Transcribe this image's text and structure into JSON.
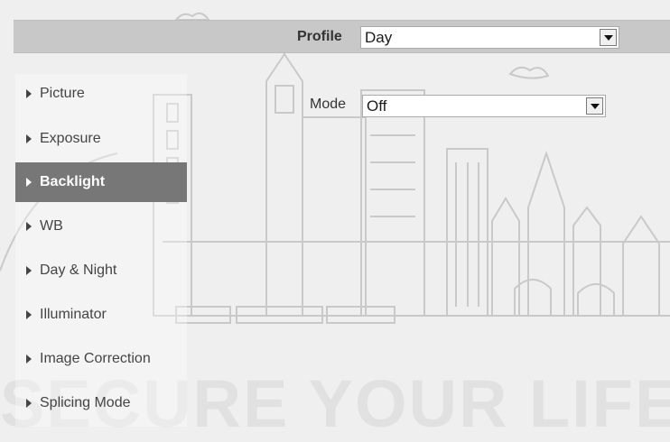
{
  "profile": {
    "label": "Profile",
    "value": "Day"
  },
  "mode": {
    "label": "Mode",
    "value": "Off"
  },
  "menu": {
    "active_index": 2,
    "items": [
      {
        "label": "Picture"
      },
      {
        "label": "Exposure"
      },
      {
        "label": "Backlight"
      },
      {
        "label": "WB"
      },
      {
        "label": "Day & Night"
      },
      {
        "label": "Illuminator"
      },
      {
        "label": "Image Correction"
      },
      {
        "label": "Splicing Mode"
      }
    ]
  },
  "background": {
    "watermark_text": "SECURE YOUR LIFE"
  },
  "colors": {
    "profile_bar": "#c8c8c8",
    "menu_active": "#777777",
    "page_background": "#efefef"
  }
}
